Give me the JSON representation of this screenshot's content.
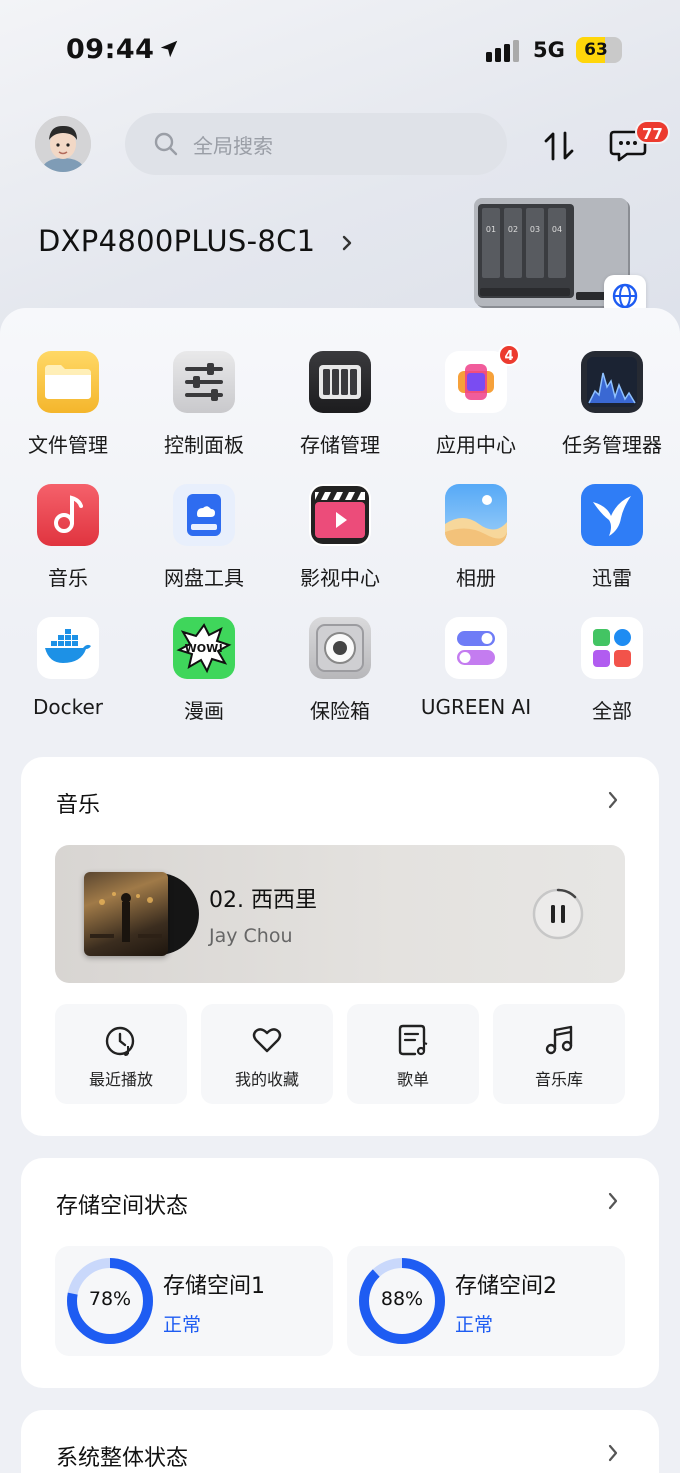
{
  "status_bar": {
    "time": "09:44",
    "network": "5G",
    "battery": "63",
    "battery_level": 0.63,
    "battery_color": "#ffd60a"
  },
  "header": {
    "search_placeholder": "全局搜索",
    "message_badge": "77",
    "badge_color": "#ec3b2f"
  },
  "device": {
    "name": "DXP4800PLUS-8C1",
    "bay_labels": [
      "01",
      "02",
      "03",
      "04"
    ]
  },
  "apps": [
    {
      "label": "文件管理",
      "icon": "folder-icon"
    },
    {
      "label": "控制面板",
      "icon": "sliders-icon"
    },
    {
      "label": "存储管理",
      "icon": "storage-icon"
    },
    {
      "label": "应用中心",
      "icon": "app-center-icon",
      "badge": "4"
    },
    {
      "label": "任务管理器",
      "icon": "activity-icon"
    },
    {
      "label": "音乐",
      "icon": "music-note-icon"
    },
    {
      "label": "网盘工具",
      "icon": "cloud-drive-icon"
    },
    {
      "label": "影视中心",
      "icon": "clapperboard-icon"
    },
    {
      "label": "相册",
      "icon": "photos-icon"
    },
    {
      "label": "迅雷",
      "icon": "thunder-bird-icon"
    },
    {
      "label": "Docker",
      "icon": "docker-whale-icon"
    },
    {
      "label": "漫画",
      "icon": "comic-wow-icon"
    },
    {
      "label": "保险箱",
      "icon": "safe-dial-icon"
    },
    {
      "label": "UGREEN AI",
      "icon": "ai-toggle-icon"
    },
    {
      "label": "全部",
      "icon": "all-apps-icon"
    }
  ],
  "music": {
    "title": "音乐",
    "now_playing": {
      "track": "02. 西西里",
      "artist": "Jay Chou"
    },
    "shortcuts": [
      {
        "label": "最近播放",
        "icon": "recent-clock-icon"
      },
      {
        "label": "我的收藏",
        "icon": "heart-icon"
      },
      {
        "label": "歌单",
        "icon": "playlist-icon"
      },
      {
        "label": "音乐库",
        "icon": "music-library-icon"
      }
    ]
  },
  "storage": {
    "title": "存储空间状态",
    "pools": [
      {
        "name": "存储空间1",
        "percent": "78%",
        "usage": 0.78,
        "status": "正常"
      },
      {
        "name": "存储空间2",
        "percent": "88%",
        "usage": 0.88,
        "status": "正常"
      }
    ],
    "ring_color": "#1e5cf2",
    "ring_track_color": "#c9d8fb"
  },
  "system": {
    "title": "系统整体状态"
  }
}
